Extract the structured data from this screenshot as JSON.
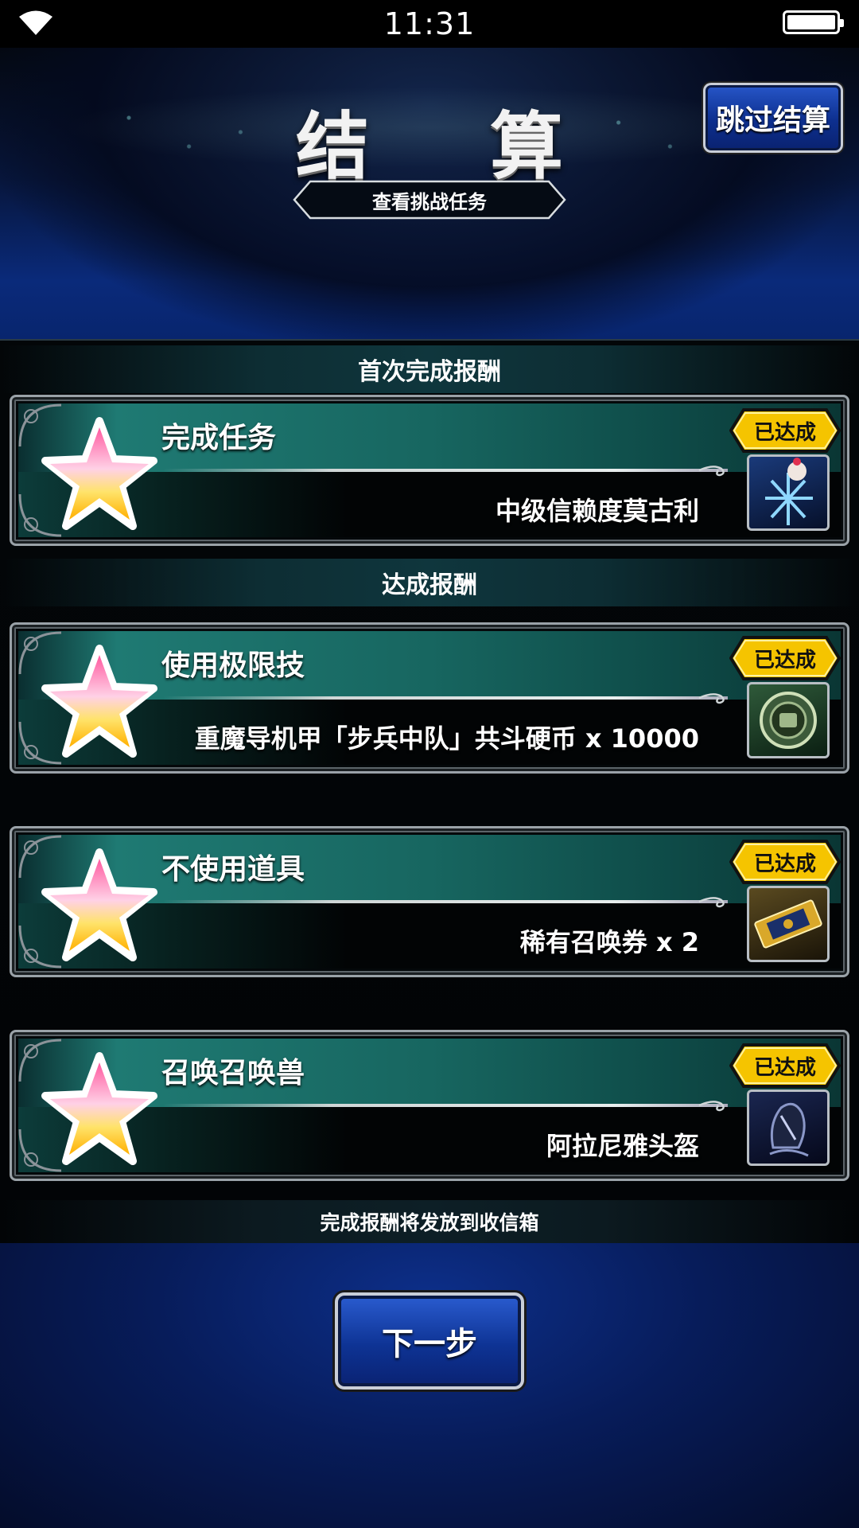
{
  "status_bar": {
    "time": "11:31"
  },
  "header": {
    "title": "结 算",
    "skip_button": "跳过结算",
    "view_missions": "查看挑战任务"
  },
  "sections": {
    "first_clear": "首次完成报酬",
    "achievements": "达成报酬"
  },
  "missions": [
    {
      "name": "完成任务",
      "reward": "中级信赖度莫古利",
      "status": "已达成",
      "item_icon": "moogle-crystal-icon"
    },
    {
      "name": "使用极限技",
      "reward": "重魔导机甲「步兵中队」共斗硬币 x 10000",
      "status": "已达成",
      "item_icon": "medal-coin-icon"
    },
    {
      "name": "不使用道具",
      "reward": "稀有召唤券 x 2",
      "status": "已达成",
      "item_icon": "ticket-icon"
    },
    {
      "name": "召唤召唤兽",
      "reward": "阿拉尼雅头盔",
      "status": "已达成",
      "item_icon": "helmet-icon"
    }
  ],
  "footer_note": "完成报酬将发放到收信箱",
  "next_button": "下一步",
  "colors": {
    "badge_gold": "#f5c400",
    "card_teal": "#1f7a73",
    "button_blue": "#0e3394"
  }
}
